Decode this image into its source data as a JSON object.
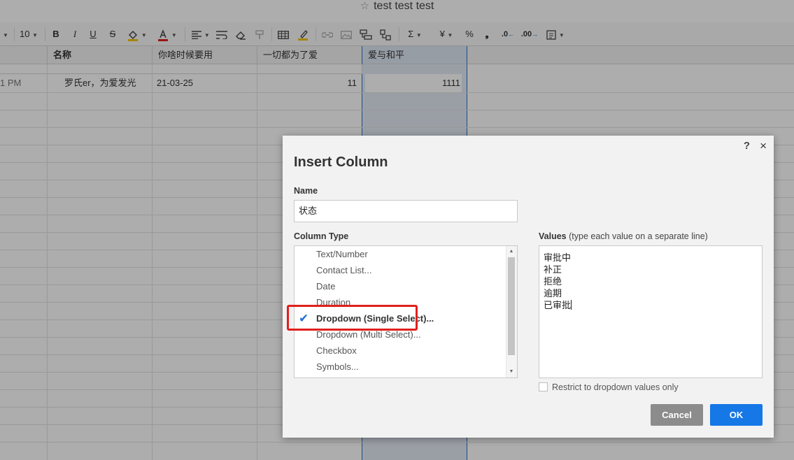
{
  "window": {
    "title": "test test test"
  },
  "toolbar": {
    "font_size": "10",
    "bold": "B",
    "italic": "I",
    "underline": "U",
    "strikethrough": "S",
    "sum": "Σ",
    "currency": "¥",
    "percent": "%",
    "thousands": "❟",
    "decimal_less": ".0",
    "decimal_more": ".00"
  },
  "sheet": {
    "columns": [
      "名称",
      "你啥时候要用",
      "一切都为了爱",
      "爱与和平"
    ],
    "row1": {
      "time": "1 PM",
      "name": "罗氏er，为爱发光",
      "date": "21-03-25",
      "number": "11",
      "peace": "1111"
    }
  },
  "dialog": {
    "title": "Insert Column",
    "help": "?",
    "close": "×",
    "name_label": "Name",
    "name_value": "状态",
    "column_type_label": "Column Type",
    "column_types": [
      {
        "label": "Text/Number",
        "selected": false
      },
      {
        "label": "Contact List...",
        "selected": false
      },
      {
        "label": "Date",
        "selected": false
      },
      {
        "label": "Duration",
        "selected": false
      },
      {
        "label": "Dropdown (Single Select)...",
        "selected": true
      },
      {
        "label": "Dropdown (Multi Select)...",
        "selected": false
      },
      {
        "label": "Checkbox",
        "selected": false
      },
      {
        "label": "Symbols...",
        "selected": false
      }
    ],
    "values_label": "Values",
    "values_hint": "(type each value on a separate line)",
    "values": [
      "审批中",
      "补正",
      "拒绝",
      "逾期",
      "已审批"
    ],
    "restrict_label": "Restrict to dropdown values only",
    "restrict_checked": false,
    "cancel_label": "Cancel",
    "ok_label": "OK"
  },
  "colors": {
    "accent": "#1677e6",
    "highlight_box": "#e0201c",
    "check": "#1d6fd6"
  }
}
